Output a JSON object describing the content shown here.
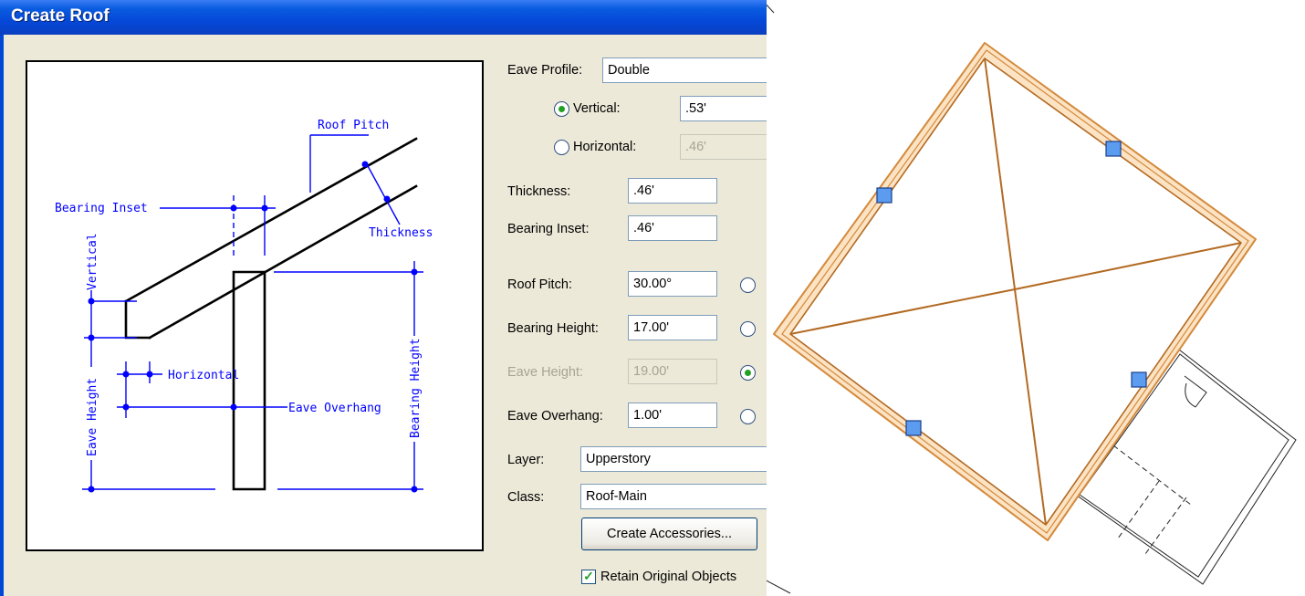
{
  "dialog": {
    "title": "Create Roof",
    "eave_profile": {
      "label": "Eave Profile:",
      "value": "Double"
    },
    "vertical": {
      "label": "Vertical:",
      "value": ".53'",
      "selected": true
    },
    "horizontal": {
      "label": "Horizontal:",
      "value": ".46'",
      "selected": false
    },
    "thickness": {
      "label": "Thickness:",
      "value": ".46'"
    },
    "bearing_inset": {
      "label": "Bearing Inset:",
      "value": ".46'"
    },
    "roof_pitch": {
      "label": "Roof Pitch:",
      "value": "30.00°"
    },
    "bearing_height": {
      "label": "Bearing Height:",
      "value": "17.00'"
    },
    "eave_height": {
      "label": "Eave Height:",
      "value": "19.00'",
      "selected": true
    },
    "eave_overhang": {
      "label": "Eave Overhang:",
      "value": "1.00'"
    },
    "layer": {
      "label": "Layer:",
      "value": "Upperstory"
    },
    "class": {
      "label": "Class:",
      "value": "Roof-Main"
    },
    "create_accessories_label": "Create Accessories...",
    "retain_original": {
      "label": "Retain Original Objects",
      "checked": true
    }
  },
  "diagram": {
    "roof_pitch": "Roof Pitch",
    "bearing_inset": "Bearing Inset",
    "thickness": "Thickness",
    "vertical": "Vertical",
    "horizontal": "Horizontal",
    "eave_overhang": "Eave Overhang",
    "eave_height": "Eave Height",
    "bearing_height": "Bearing Height"
  },
  "colors": {
    "dialog_bg": "#ece9d8",
    "title_bar": "#0a5ce0",
    "diagram_blue": "#0000ff",
    "roof_outline": "#d48a3c",
    "roof_fill": "#fbe3c4",
    "handle": "#5b9cf0"
  }
}
